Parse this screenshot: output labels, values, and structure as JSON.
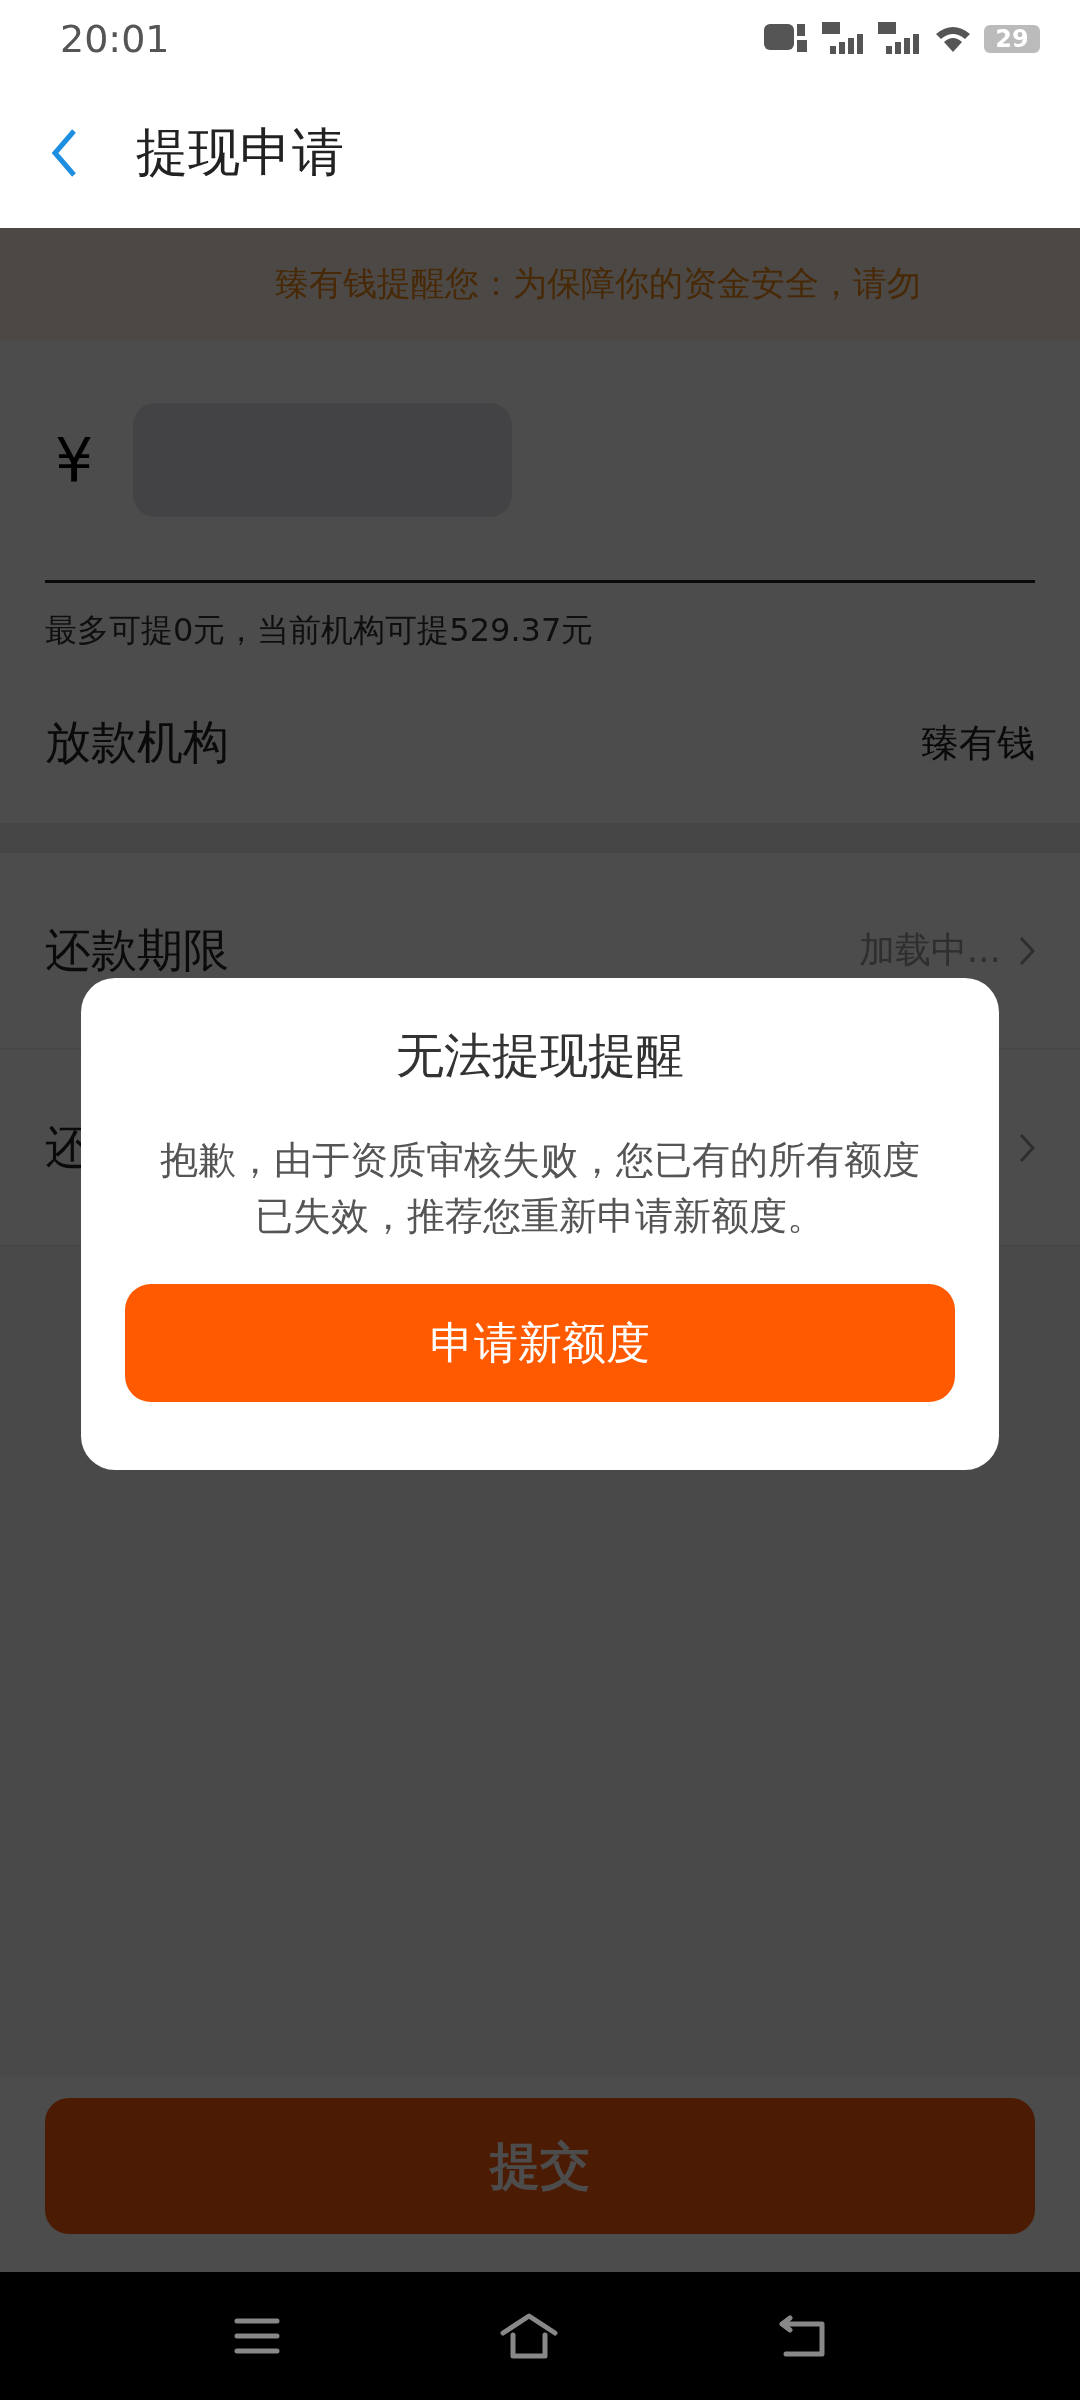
{
  "status_bar": {
    "time": "20:01",
    "battery": "29"
  },
  "header": {
    "title": "提现申请"
  },
  "notice": {
    "text": "臻有钱提醒您：为保障你的资金安全，请勿"
  },
  "amount": {
    "currency": "¥",
    "hint": "最多可提0元，当前机构可提529.37元"
  },
  "lender": {
    "label": "放款机构",
    "value": "臻有钱"
  },
  "rows": [
    {
      "label": "还款期限",
      "value": "加载中..."
    },
    {
      "label": "还"
    }
  ],
  "dialog": {
    "title": "无法提现提醒",
    "message": "抱歉，由于资质审核失败，您已有的所有额度已失效，推荐您重新申请新额度。",
    "button": "申请新额度"
  },
  "submit": {
    "label": "提交"
  }
}
